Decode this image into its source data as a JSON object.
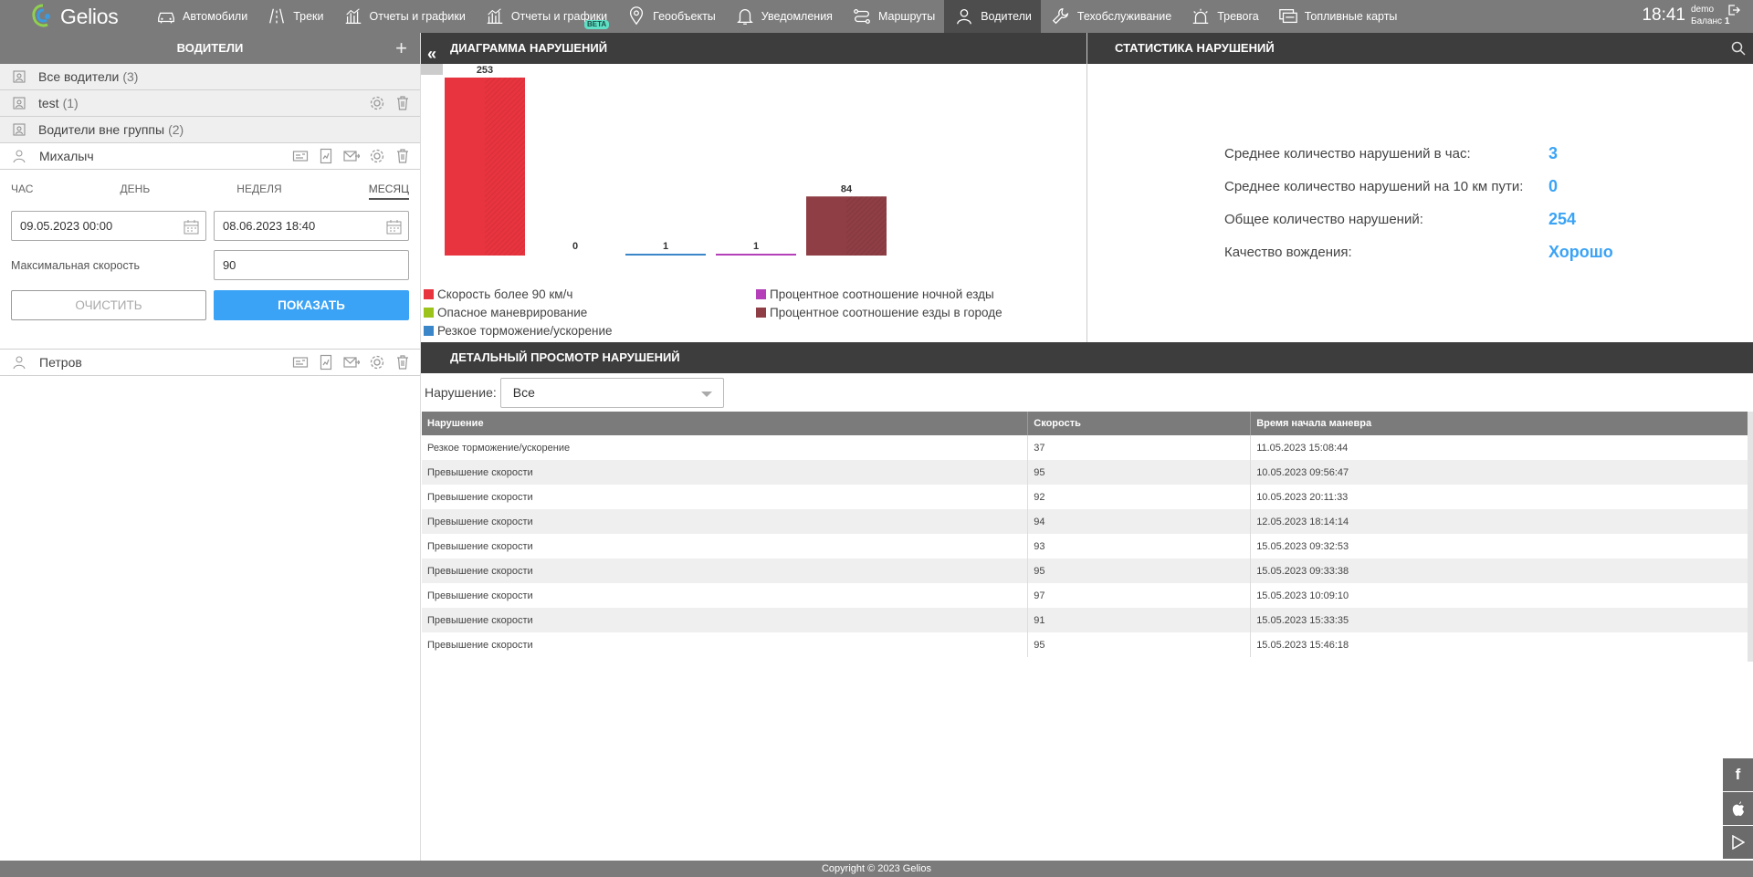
{
  "app": {
    "logo": "Gelios",
    "clock": "18:41",
    "user": "demo",
    "balance_label": "Баланс",
    "balance_value": "1"
  },
  "nav": [
    {
      "label": "Автомобили",
      "icon": "car-icon"
    },
    {
      "label": "Треки",
      "icon": "road-icon"
    },
    {
      "label": "Отчеты и графики",
      "icon": "chart-icon"
    },
    {
      "label": "Отчеты и графики",
      "icon": "chart-icon",
      "badge": "BETA"
    },
    {
      "label": "Геообъекты",
      "icon": "map-pin-icon"
    },
    {
      "label": "Уведомления",
      "icon": "bell-icon"
    },
    {
      "label": "Маршруты",
      "icon": "route-icon"
    },
    {
      "label": "Водители",
      "icon": "user-icon",
      "active": true
    },
    {
      "label": "Техобслуживание",
      "icon": "wrench-icon"
    },
    {
      "label": "Тревога",
      "icon": "alarm-icon"
    },
    {
      "label": "Топливные карты",
      "icon": "fuel-card-icon"
    }
  ],
  "drivers_panel": {
    "title": "ВОДИТЕЛИ",
    "groups": [
      {
        "label": "Все водители",
        "count": "(3)"
      },
      {
        "label": "test",
        "count": "(1)"
      },
      {
        "label": "Водители вне группы",
        "count": "(2)"
      }
    ],
    "drivers": [
      "Михалыч",
      "Петров"
    ],
    "period_tabs": [
      "ЧАС",
      "ДЕНЬ",
      "НЕДЕЛЯ",
      "МЕСЯЦ"
    ],
    "active_period": "МЕСЯЦ",
    "date_from": "09.05.2023 00:00",
    "date_to": "08.06.2023 18:40",
    "max_speed_label": "Максимальная скорость",
    "max_speed_value": "90",
    "clear_label": "ОЧИСТИТЬ",
    "show_label": "ПОКАЗАТЬ"
  },
  "chart_panel": {
    "title": "ДИАГРАММА НАРУШЕНИЙ"
  },
  "chart_data": {
    "type": "bar",
    "categories": [
      "Скорость более 90 км/ч",
      "Опасное маневрирование",
      "Резкое торможение/ускорение",
      "Процентное соотношение ночной езды",
      "Процентное соотношение езды в городе"
    ],
    "values": [
      253,
      0,
      1,
      1,
      84
    ],
    "colors": [
      "#e8343f",
      "#9bc31c",
      "#3a86c8",
      "#b43fb8",
      "#8e3e44"
    ],
    "title": "",
    "xlabel": "",
    "ylabel": "",
    "ylim": [
      0,
      253
    ],
    "legend": [
      {
        "label": "Скорость более 90 км/ч",
        "color": "#e8343f"
      },
      {
        "label": "Процентное соотношение ночной езды",
        "color": "#b43fb8"
      },
      {
        "label": "Опасное маневрирование",
        "color": "#9bc31c"
      },
      {
        "label": "Процентное соотношение езды в городе",
        "color": "#8e3e44"
      },
      {
        "label": "Резкое торможение/ускорение",
        "color": "#3a86c8"
      }
    ]
  },
  "stats_panel": {
    "title": "СТАТИСТИКА НАРУШЕНИЙ",
    "rows": [
      {
        "label": "Среднее количество нарушений в час:",
        "value": "3"
      },
      {
        "label": "Среднее количество нарушений на 10 км пути:",
        "value": "0"
      },
      {
        "label": "Общее количество нарушений:",
        "value": "254"
      },
      {
        "label": "Качество вождения:",
        "value": "Хорошо"
      }
    ]
  },
  "detail_panel": {
    "title": "ДЕТАЛЬНЫЙ ПРОСМОТР НАРУШЕНИЙ",
    "filter_label": "Нарушение:",
    "filter_value": "Все",
    "columns": [
      "Нарушение",
      "Скорость",
      "Время начала маневра"
    ],
    "rows": [
      [
        "Резкое торможение/ускорение",
        "37",
        "11.05.2023 15:08:44"
      ],
      [
        "Превышение скорости",
        "95",
        "10.05.2023 09:56:47"
      ],
      [
        "Превышение скорости",
        "92",
        "10.05.2023 20:11:33"
      ],
      [
        "Превышение скорости",
        "94",
        "12.05.2023 18:14:14"
      ],
      [
        "Превышение скорости",
        "93",
        "15.05.2023 09:32:53"
      ],
      [
        "Превышение скорости",
        "95",
        "15.05.2023 09:33:38"
      ],
      [
        "Превышение скорости",
        "97",
        "15.05.2023 10:09:10"
      ],
      [
        "Превышение скорости",
        "91",
        "15.05.2023 15:33:35"
      ],
      [
        "Превышение скорости",
        "95",
        "15.05.2023 15:46:18"
      ]
    ]
  },
  "social": [
    "facebook-icon",
    "apple-icon",
    "google-play-icon"
  ],
  "footer": "Copyright © 2023 Gelios"
}
